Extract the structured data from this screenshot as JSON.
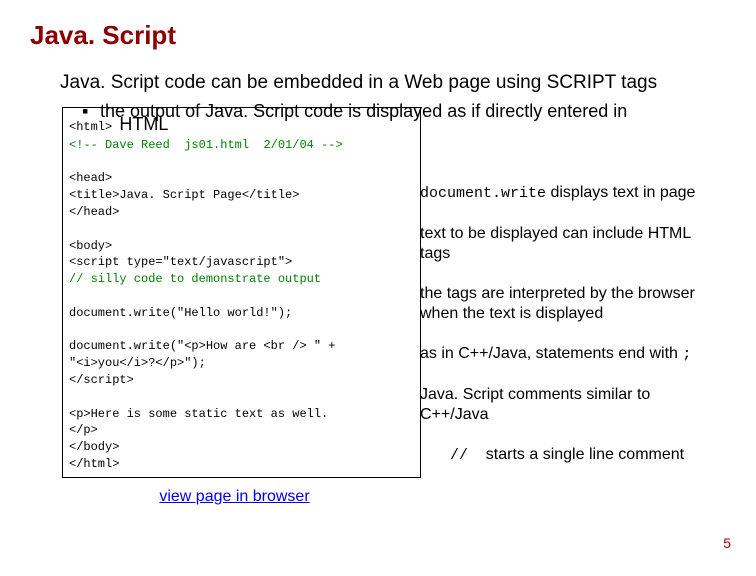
{
  "title": "Java. Script",
  "intro": "Java. Script code can be embedded in a Web page using SCRIPT tags",
  "bullet": "the output of Java. Script code is displayed as if directly entered in",
  "bullet_cont": "HTML",
  "code": {
    "l1a": "<html>",
    "l1b": "<!-- Dave Reed",
    "l1c": "js01.html",
    "l1d": "2/01/04 -->",
    "l2": "<head>",
    "l3": "  <title>Java. Script Page</title>",
    "l4": "</head>",
    "l5": "<body>",
    "l6": "  <script type=\"text/javascript\">",
    "l7": "    // silly code to demonstrate output",
    "l8": "    document.write(\"Hello world!\");",
    "l9": "    document.write(\"<p>How are <br /> \" +",
    "l10": "                   \"<i>you</i>?</p>\");",
    "l11": "  </script>",
    "l12": "  <p>Here is some static text as well.",
    "l13": "  </p>",
    "l14": "</body>",
    "l15": "</html>"
  },
  "notes": {
    "n1a": "document.write",
    "n1b": " displays text in page",
    "n2": "text to be displayed can include HTML tags",
    "n3": "the tags are interpreted by the browser when the text is displayed",
    "n4a": "as in C++/Java, statements end with ",
    "n4b": ";",
    "n5": "Java. Script comments similar to C++/Java",
    "n6a": "//",
    "n6b": "starts a single line comment"
  },
  "link_text": "view page in browser",
  "page_number": "5"
}
